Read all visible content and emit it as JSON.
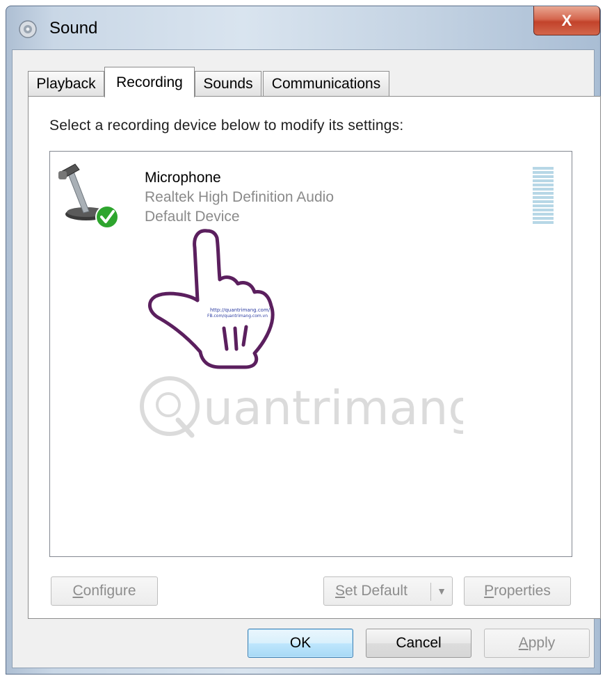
{
  "window": {
    "title": "Sound",
    "close_label": "X"
  },
  "tabs": [
    {
      "label": "Playback",
      "active": false
    },
    {
      "label": "Recording",
      "active": true
    },
    {
      "label": "Sounds",
      "active": false
    },
    {
      "label": "Communications",
      "active": false
    }
  ],
  "panel": {
    "instruction": "Select a recording device below to modify its settings:"
  },
  "devices": [
    {
      "name": "Microphone",
      "description": "Realtek High Definition Audio",
      "status": "Default Device",
      "icon": "microphone-icon",
      "default_badge_icon": "check-badge-icon",
      "level": 0
    }
  ],
  "overlay": {
    "hand_caption_1": "http://quantrimang.com/",
    "hand_caption_2": "FB.com/quantrimang.com.vn",
    "watermark_text": "uantrimang"
  },
  "panel_buttons": {
    "configure": "Configure",
    "set_default": "Set Default",
    "properties": "Properties"
  },
  "dialog_buttons": {
    "ok": "OK",
    "cancel": "Cancel",
    "apply": "Apply"
  },
  "colors": {
    "close_button": "#c9472f",
    "default_check": "#2ea52e",
    "meter": "#b7d7e6",
    "hand_outline": "#5b1f5e"
  }
}
